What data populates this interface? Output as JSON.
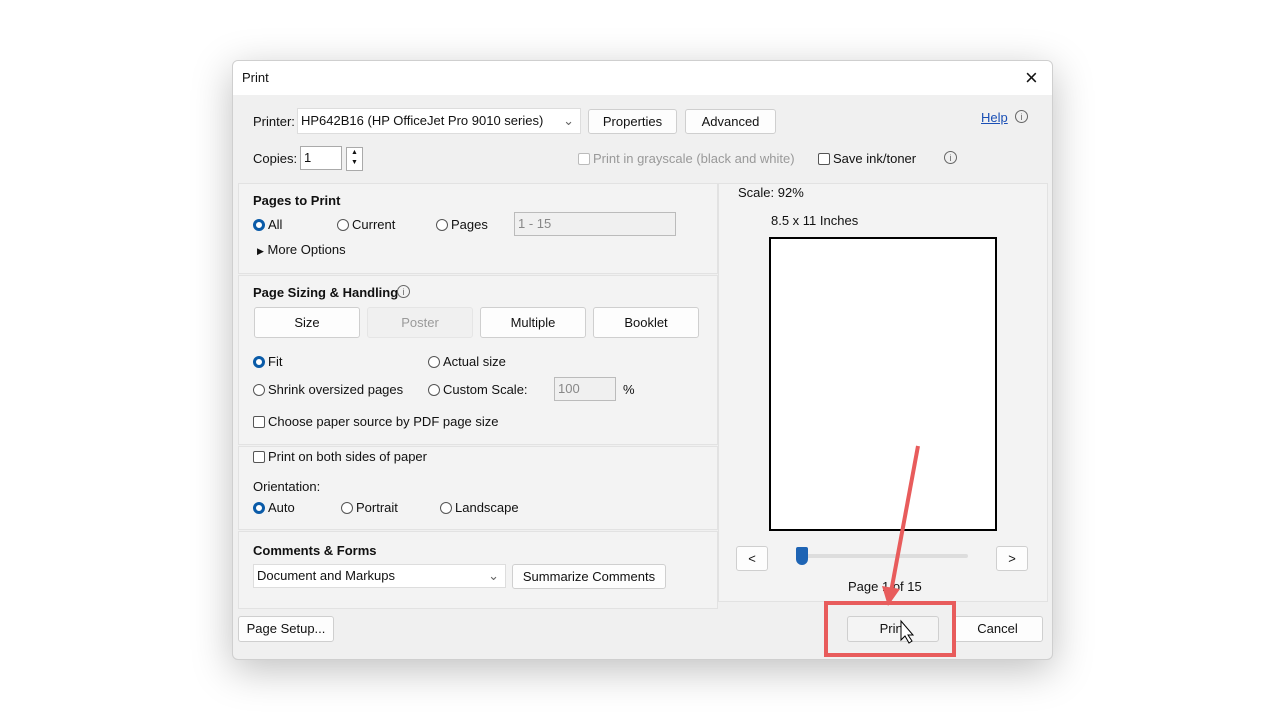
{
  "dialog": {
    "title": "Print",
    "close": "×"
  },
  "printer": {
    "label": "Printer:",
    "value": "HP642B16 (HP OfficeJet Pro 9010 series)",
    "properties": "Properties",
    "advanced": "Advanced",
    "help": "Help"
  },
  "copies": {
    "label": "Copies:",
    "value": "1",
    "grayscale": "Print in grayscale (black and white)",
    "save_ink": "Save ink/toner"
  },
  "pages": {
    "title": "Pages to Print",
    "all": "All",
    "current": "Current",
    "pages": "Pages",
    "range_placeholder": "1 - 15",
    "more": "More Options"
  },
  "sizing": {
    "title": "Page Sizing & Handling",
    "size": "Size",
    "poster": "Poster",
    "multiple": "Multiple",
    "booklet": "Booklet",
    "fit": "Fit",
    "actual": "Actual size",
    "shrink": "Shrink oversized pages",
    "custom": "Custom Scale:",
    "custom_value": "100",
    "percent": "%",
    "paper_source": "Choose paper source by PDF page size"
  },
  "duplex": {
    "both_sides": "Print on both sides of paper",
    "orientation": "Orientation:",
    "auto": "Auto",
    "portrait": "Portrait",
    "landscape": "Landscape"
  },
  "comments": {
    "title": "Comments & Forms",
    "value": "Document and Markups",
    "summarize": "Summarize Comments"
  },
  "preview": {
    "scale": "Scale:  92%",
    "paper": "8.5 x 11 Inches",
    "prev": "<",
    "next": ">",
    "page_label": "Page 1 of 15",
    "slider_position": 0
  },
  "footer": {
    "page_setup": "Page Setup...",
    "print": "Print",
    "cancel": "Cancel"
  },
  "annotation": {
    "color": "#e85c5c"
  }
}
